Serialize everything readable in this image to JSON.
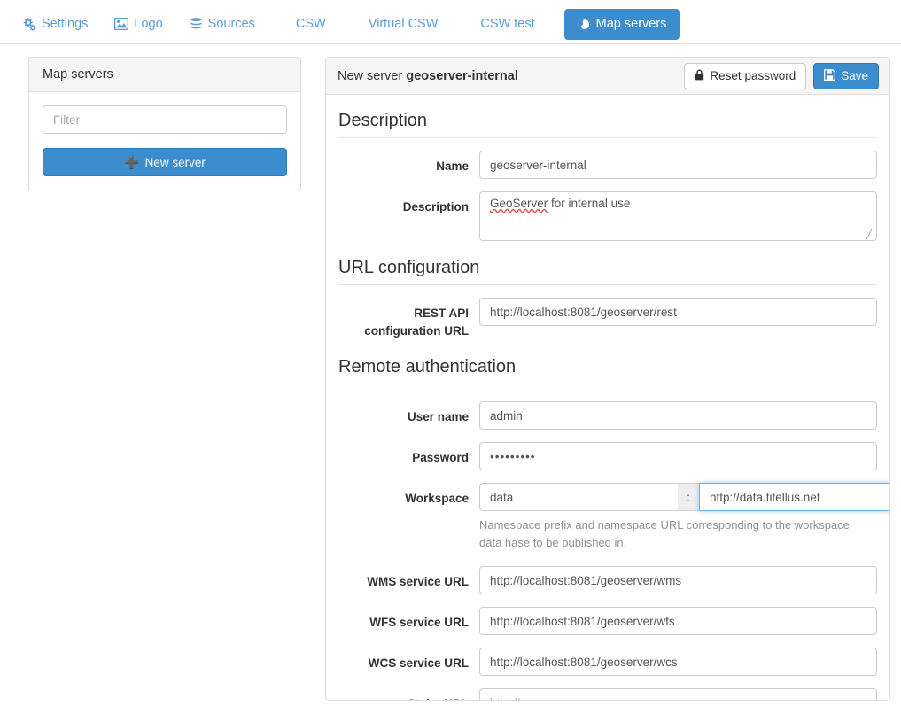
{
  "nav": {
    "tabs": [
      {
        "label": "Settings",
        "icon": "gears-icon",
        "active": false
      },
      {
        "label": "Logo",
        "icon": "image-icon",
        "active": false
      },
      {
        "label": "Sources",
        "icon": "database-icon",
        "active": false
      },
      {
        "label": "CSW",
        "icon": "",
        "active": false
      },
      {
        "label": "Virtual CSW",
        "icon": "",
        "active": false
      },
      {
        "label": "CSW test",
        "icon": "",
        "active": false
      },
      {
        "label": "Map servers",
        "icon": "globe-icon",
        "active": true
      }
    ]
  },
  "sidebar": {
    "title": "Map servers",
    "filter": {
      "value": "",
      "placeholder": "Filter"
    },
    "new_server_label": "New server",
    "new_server_icon": "plus-icon"
  },
  "server_panel": {
    "heading_prefix": "New server",
    "heading_name": "geoserver-internal",
    "reset_password_label": "Reset password",
    "reset_password_icon": "lock-icon",
    "save_label": "Save",
    "save_icon": "floppy-disk-icon",
    "sections": {
      "description": {
        "title": "Description",
        "name_label": "Name",
        "name_value": "geoserver-internal",
        "description_label": "Description",
        "description_value_spellchecked": "GeoServer",
        "description_value_rest": " for internal use"
      },
      "url_configuration": {
        "title": "URL configuration",
        "rest_api_label": "REST API configuration URL",
        "rest_api_value": "http://localhost:8081/geoserver/rest"
      },
      "remote_authentication": {
        "title": "Remote authentication",
        "username_label": "User name",
        "username_value": "admin",
        "password_label": "Password",
        "password_value": "•••••••••",
        "workspace_label": "Workspace",
        "workspace_prefix_value": "data",
        "workspace_separator": ":",
        "workspace_url_value": "http://data.titellus.net",
        "workspace_help": "Namespace prefix and namespace URL corresponding to the workspace data hase to be published in.",
        "wms_label": "WMS service URL",
        "wms_value": "http://localhost:8081/geoserver/wms",
        "wfs_label": "WFS service URL",
        "wfs_value": "http://localhost:8081/geoserver/wfs",
        "wcs_label": "WCS service URL",
        "wcs_value": "http://localhost:8081/geoserver/wcs",
        "styler_label": "Styler URL",
        "styler_value": "",
        "styler_placeholder": "http://"
      }
    }
  },
  "colors": {
    "accent": "#3c8dcd",
    "link": "#5b9bd5",
    "focus": "#66afe9",
    "panel_border": "#dddddd",
    "muted": "#8c9097"
  }
}
